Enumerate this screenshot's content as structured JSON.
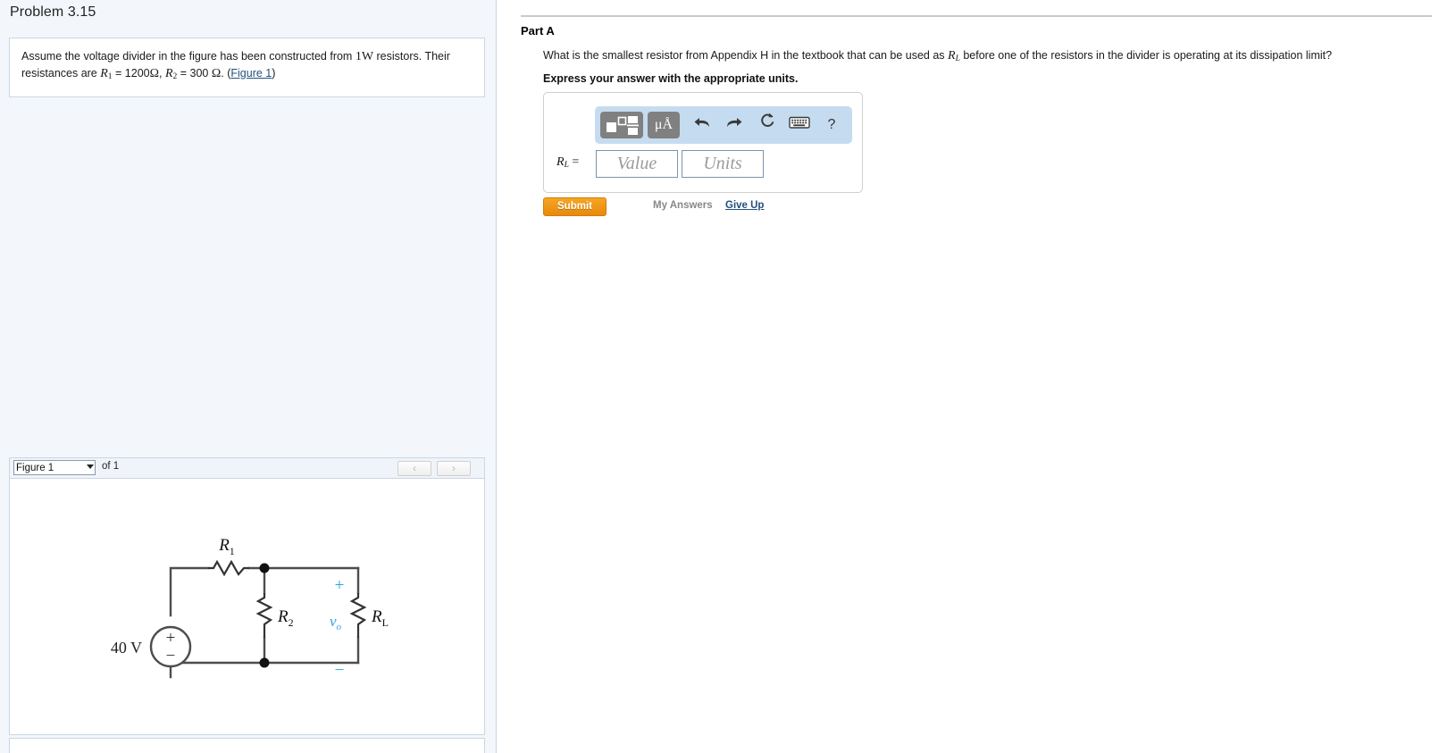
{
  "left": {
    "problem_title": "Problem 3.15",
    "statement": {
      "part1": "Assume the voltage divider in the figure has been constructed from ",
      "power": "1W",
      "part2": " resistors. Their resistances are ",
      "r1_sym": "R",
      "r1_sub": "1",
      "eq1": " = 1200",
      "ohm1": "Ω",
      "sep": ", ",
      "r2_sym": "R",
      "r2_sub": "2",
      "eq2": " = 300 ",
      "ohm2": "Ω",
      "period": ". (",
      "figure_link": "Figure 1",
      "close": ")"
    },
    "figure_nav": {
      "select_value": "Figure 1",
      "options": [
        "Figure 1"
      ],
      "of_text": "of 1",
      "prev_label": "‹",
      "next_label": "›"
    }
  },
  "circuit": {
    "source_label": "40 V",
    "source_plus": "+",
    "source_minus": "−",
    "r1_label": "R",
    "r1_sub": "1",
    "r2_label": "R",
    "r2_sub": "2",
    "rl_label": "R",
    "rl_sub": "L",
    "vo_label": "v",
    "vo_sub": "o",
    "vo_plus": "+",
    "vo_minus": "−",
    "accent_blue": "#29a3dc",
    "wire_color": "#4d4d4d"
  },
  "right": {
    "part_title": "Part A",
    "question": {
      "before": "What is the smallest resistor from Appendix H in the textbook that can be used as ",
      "rl_sym": "R",
      "rl_sub": "L",
      "after": " before one of the resistors in the divider is operating at its dissipation limit?"
    },
    "express_line": "Express your answer with the appropriate units.",
    "toolbar": {
      "template_icon": "template-icon",
      "units_label": "μÅ",
      "undo_icon": "⬅",
      "redo_icon": "➡",
      "reset_icon": "↻",
      "keyboard_icon": "keyboard-icon",
      "help_label": "?"
    },
    "answer": {
      "label_sym": "R",
      "label_sub": "L",
      "label_eq": " =",
      "value_placeholder": "Value",
      "units_placeholder": "Units"
    },
    "submit_label": "Submit",
    "my_answers_label": "My Answers",
    "give_up_label": "Give Up"
  }
}
